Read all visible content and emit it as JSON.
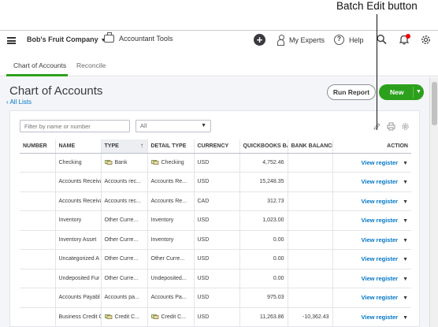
{
  "callout": {
    "text": "Batch Edit button"
  },
  "topbar": {
    "company": "Bob's Fruit Company",
    "accountant_tools": "Accountant Tools",
    "my_experts": "My Experts",
    "help": "Help"
  },
  "tabs": [
    {
      "label": "Chart of Accounts",
      "active": true
    },
    {
      "label": "Reconcile",
      "active": false
    }
  ],
  "page": {
    "title": "Chart of Accounts",
    "back_link": "All Lists",
    "run_report": "Run Report",
    "new": "New"
  },
  "filter": {
    "placeholder": "Filter by name or number",
    "select_value": "All"
  },
  "table": {
    "headers": [
      "NUMBER",
      "NAME",
      "TYPE",
      "DETAIL TYPE",
      "CURRENCY",
      "QUICKBOOKS BA",
      "BANK BALANCE",
      "ACTION"
    ],
    "action_label": "View register",
    "rows": [
      {
        "number": "",
        "name": "Checking",
        "type": "Bank",
        "detail": "Checking",
        "currency": "USD",
        "qb": "4,752.46",
        "bank": "",
        "type_icon": true
      },
      {
        "number": "",
        "name": "Accounts Receiva",
        "type": "Accounts rec...",
        "detail": "Accounts Re...",
        "currency": "USD",
        "qb": "15,248.35",
        "bank": ""
      },
      {
        "number": "",
        "name": "Accounts Receiva",
        "type": "Accounts rec...",
        "detail": "Accounts Re...",
        "currency": "CAD",
        "qb": "312.73",
        "bank": ""
      },
      {
        "number": "",
        "name": "Inventory",
        "type": "Other Curre...",
        "detail": "Inventory",
        "currency": "USD",
        "qb": "1,023.00",
        "bank": ""
      },
      {
        "number": "",
        "name": "Inventory Asset",
        "type": "Other Curre...",
        "detail": "Inventory",
        "currency": "USD",
        "qb": "0.00",
        "bank": ""
      },
      {
        "number": "",
        "name": "Uncategorized A",
        "type": "Other Curre...",
        "detail": "Other Curre...",
        "currency": "USD",
        "qb": "0.00",
        "bank": ""
      },
      {
        "number": "",
        "name": "Undeposited Fur",
        "type": "Other Curre...",
        "detail": "Undeposited...",
        "currency": "USD",
        "qb": "0.00",
        "bank": ""
      },
      {
        "number": "",
        "name": "Accounts Payabl",
        "type": "Accounts pa...",
        "detail": "Accounts Pa...",
        "currency": "USD",
        "qb": "975.03",
        "bank": ""
      },
      {
        "number": "",
        "name": "Business Credit C",
        "type": "Credit C...",
        "detail": "Credit C...",
        "currency": "USD",
        "qb": "11,263.86",
        "bank": "-10,362.43",
        "type_icon": true
      }
    ]
  }
}
